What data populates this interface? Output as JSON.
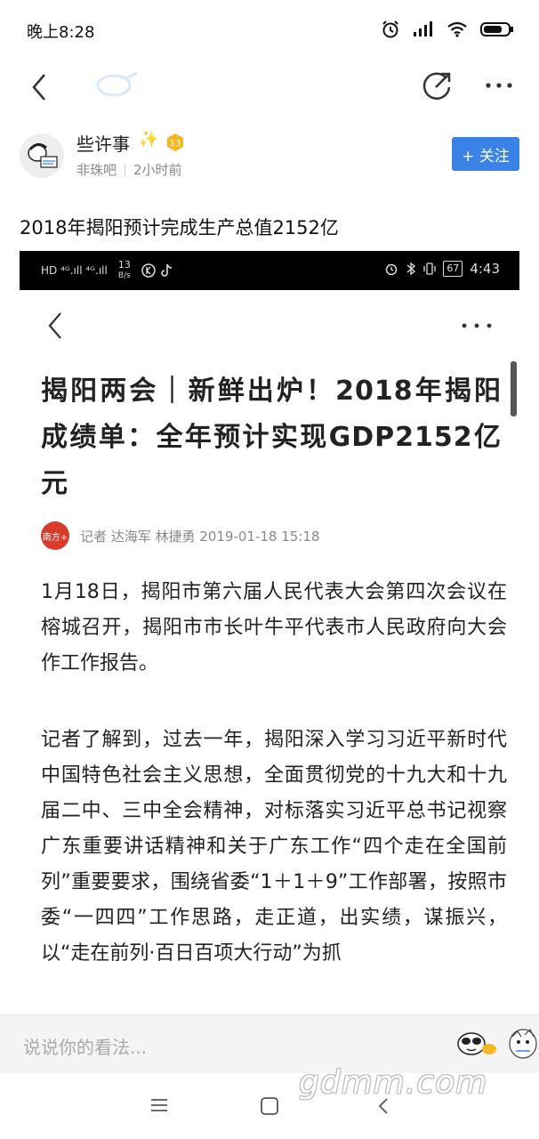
{
  "status_bar": {
    "time": "晚上8:28"
  },
  "post": {
    "author": "些许事",
    "level": "13",
    "forum": "非珠吧",
    "time_ago": "2小时前",
    "follow_label": "+ 关注",
    "title": "2018年揭阳预计完成生产总值2152亿"
  },
  "embedded": {
    "status_bar": {
      "network": "HD ⁴ᴳ.ıll ⁴ᴳ.ıll",
      "speed_value": "13",
      "speed_unit": "B/s",
      "battery": "67",
      "time": "4:43"
    },
    "article": {
      "title": "揭阳两会｜新鲜出炉！2018年揭阳成绩单：全年预计实现GDP2152亿元",
      "logo_text": "南方+",
      "byline": "记者 达海军 林捷勇  2019-01-18 15:18",
      "paragraph1": "1月18日，揭阳市第六届人民代表大会第四次会议在榕城召开，揭阳市市长叶牛平代表市人民政府向大会作工作报告。",
      "paragraph2": "记者了解到，过去一年，揭阳深入学习习近平新时代中国特色社会主义思想，全面贯彻党的十九大和十九届二中、三中全会精神，对标落实习近平总书记视察广东重要讲话精神和关于广东工作“四个走在全国前列”重要要求，围绕省委“1＋1＋9”工作部署，按照市委“一四四”工作思路，走正道，出实绩，谋振兴，以“走在前列·百日百项大行动”为抓"
    }
  },
  "comment_bar": {
    "placeholder": "说说你的看法..."
  },
  "watermark": "gdmm.com",
  "colors": {
    "accent": "#3b82e6",
    "logo_red": "#d83a2b"
  },
  "icons": [
    "alarm-icon",
    "signal-icon",
    "wifi-icon",
    "battery-icon",
    "back-icon",
    "share-icon",
    "more-icon",
    "emoji-icon",
    "sticker-icon",
    "menu-icon",
    "home-icon"
  ]
}
